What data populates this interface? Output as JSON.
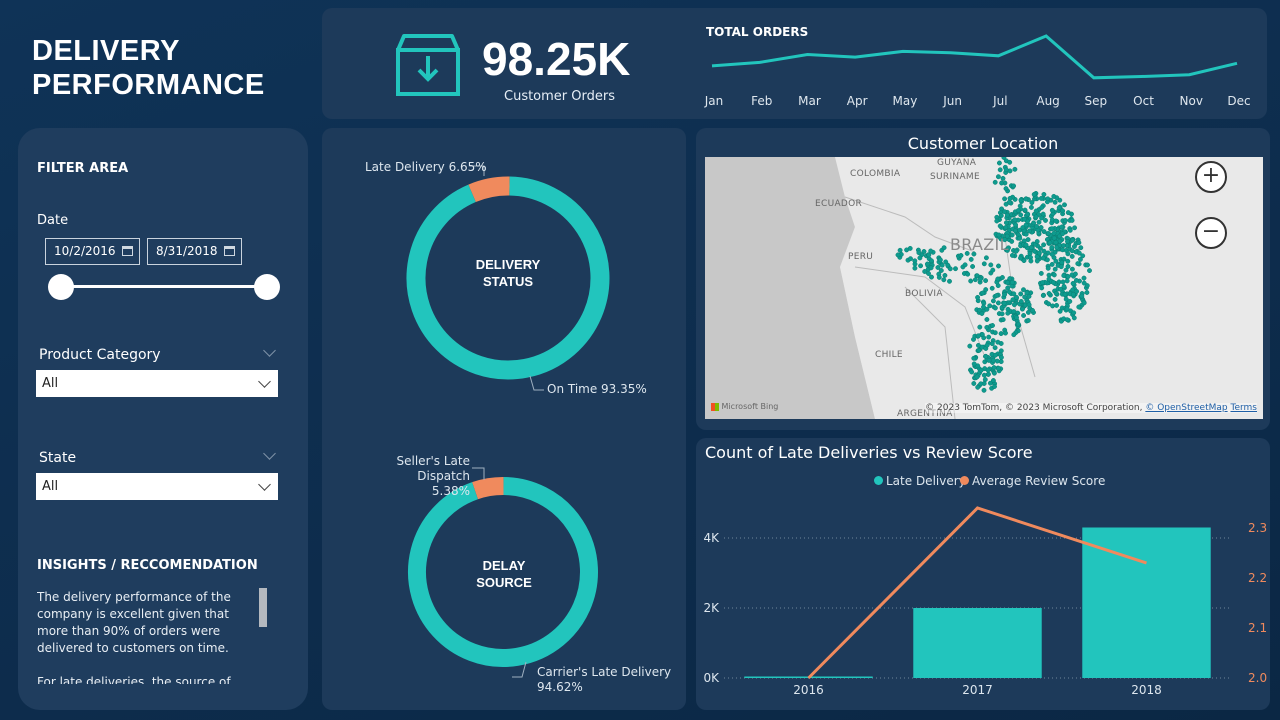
{
  "title": {
    "line1": "DELIVERY",
    "line2": "PERFORMANCE"
  },
  "kpi": {
    "value": "98.25K",
    "label": "Customer Orders",
    "icon": "download-box-icon"
  },
  "total_orders": {
    "title": "TOTAL ORDERS",
    "months": [
      "Jan",
      "Feb",
      "Mar",
      "Apr",
      "May",
      "Jun",
      "Jul",
      "Aug",
      "Sep",
      "Oct",
      "Nov",
      "Dec"
    ],
    "relative_values": [
      0.32,
      0.4,
      0.58,
      0.52,
      0.65,
      0.62,
      0.55,
      1.0,
      0.05,
      0.08,
      0.12,
      0.38
    ]
  },
  "filter": {
    "title": "FILTER AREA",
    "date_label": "Date",
    "start_date": "10/2/2016",
    "end_date": "8/31/2018",
    "product_category_label": "Product Category",
    "product_category_value": "All",
    "state_label": "State",
    "state_value": "All",
    "insights_title": "INSIGHTS / RECCOMENDATION",
    "insights_p1": "The delivery performance of the company is excellent given that more than 90% of orders were delivered to customers on time.",
    "insights_p2": "For late deliveries, the source of delay is"
  },
  "delivery_status": {
    "center_line1": "DELIVERY",
    "center_line2": "STATUS",
    "late_label": "Late Delivery 6.65%",
    "ontime_label": "On Time 93.35%",
    "late_pct": 6.65,
    "ontime_pct": 93.35
  },
  "delay_source": {
    "center_line1": "DELAY",
    "center_line2": "SOURCE",
    "seller_label_line1": "Seller's Late Dispatch",
    "seller_label_line2": "5.38%",
    "carrier_label_line1": "Carrier's Late Delivery",
    "carrier_label_line2": "94.62%",
    "seller_pct": 5.38,
    "carrier_pct": 94.62
  },
  "map": {
    "title": "Customer Location",
    "countries": [
      "GUYANA",
      "COLOMBIA",
      "SURINAME",
      "ECUADOR",
      "PERU",
      "BRAZIL",
      "BOLIVIA",
      "CHILE",
      "ARGENTINA"
    ],
    "attribution": "© 2023 TomTom, © 2023 Microsoft Corporation,",
    "osm": "© OpenStreetMap",
    "terms": "Terms",
    "bing": "Microsoft Bing",
    "zoom_in": "+",
    "zoom_out": "−"
  },
  "colors": {
    "teal": "#22c5bd",
    "orange": "#f08a5d",
    "panel": "#1d3a5a"
  },
  "chart_data": {
    "type": "bar",
    "title": "Count of Late Deliveries vs Review Score",
    "categories": [
      "2016",
      "2017",
      "2018"
    ],
    "series": [
      {
        "name": "Late Delivery",
        "type": "bar",
        "axis": "left",
        "values": [
          20,
          2000,
          4300
        ]
      },
      {
        "name": "Average Review Score",
        "type": "line",
        "axis": "right",
        "values": [
          2.0,
          2.34,
          2.23
        ]
      }
    ],
    "y_left": {
      "ticks": [
        "0K",
        "2K",
        "4K"
      ],
      "range": [
        0,
        5000
      ]
    },
    "y_right": {
      "ticks": [
        "2.0",
        "2.1",
        "2.2",
        "2.3"
      ],
      "range": [
        2.0,
        2.35
      ]
    },
    "legend_position": "top"
  }
}
